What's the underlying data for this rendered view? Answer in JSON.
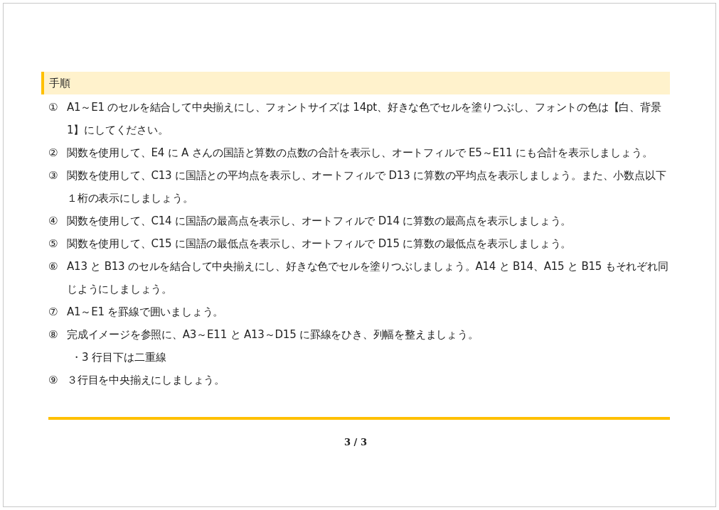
{
  "section": {
    "title": "手順"
  },
  "steps": [
    {
      "number": "①",
      "text": "A1～E1 のセルを結合して中央揃えにし、フォントサイズは 14pt、好きな色でセルを塗りつぶし、フォントの色は【白、背景 1】にしてください。"
    },
    {
      "number": "②",
      "text": "関数を使用して、E4 に A さんの国語と算数の点数の合計を表示し、オートフィルで E5～E11 にも合計を表示しましょう。"
    },
    {
      "number": "③",
      "text": "関数を使用して、C13 に国語との平均点を表示し、オートフィルで D13 に算数の平均点を表示しましょう。また、小数点以下１桁の表示にしましょう。"
    },
    {
      "number": "④",
      "text": "関数を使用して、C14 に国語の最高点を表示し、オートフィルで D14 に算数の最高点を表示しましょう。"
    },
    {
      "number": "⑤",
      "text": "関数を使用して、C15 に国語の最低点を表示し、オートフィルで D15 に算数の最低点を表示しましょう。"
    },
    {
      "number": "⑥",
      "text": "A13 と B13 のセルを結合して中央揃えにし、好きな色でセルを塗りつぶしましょう。A14 と B14、A15 と B15 もそれぞれ同じようにしましょう。"
    },
    {
      "number": "⑦",
      "text": "A1～E1 を罫線で囲いましょう。"
    },
    {
      "number": "⑧",
      "text": "完成イメージを参照に、A3～E11 と A13～D15 に罫線をひき、列幅を整えましょう。",
      "notes": [
        "・3 行目下は二重線"
      ]
    },
    {
      "number": "⑨",
      "text": "３行目を中央揃えにしましょう。"
    }
  ],
  "footer": {
    "page": "3 / 3"
  }
}
